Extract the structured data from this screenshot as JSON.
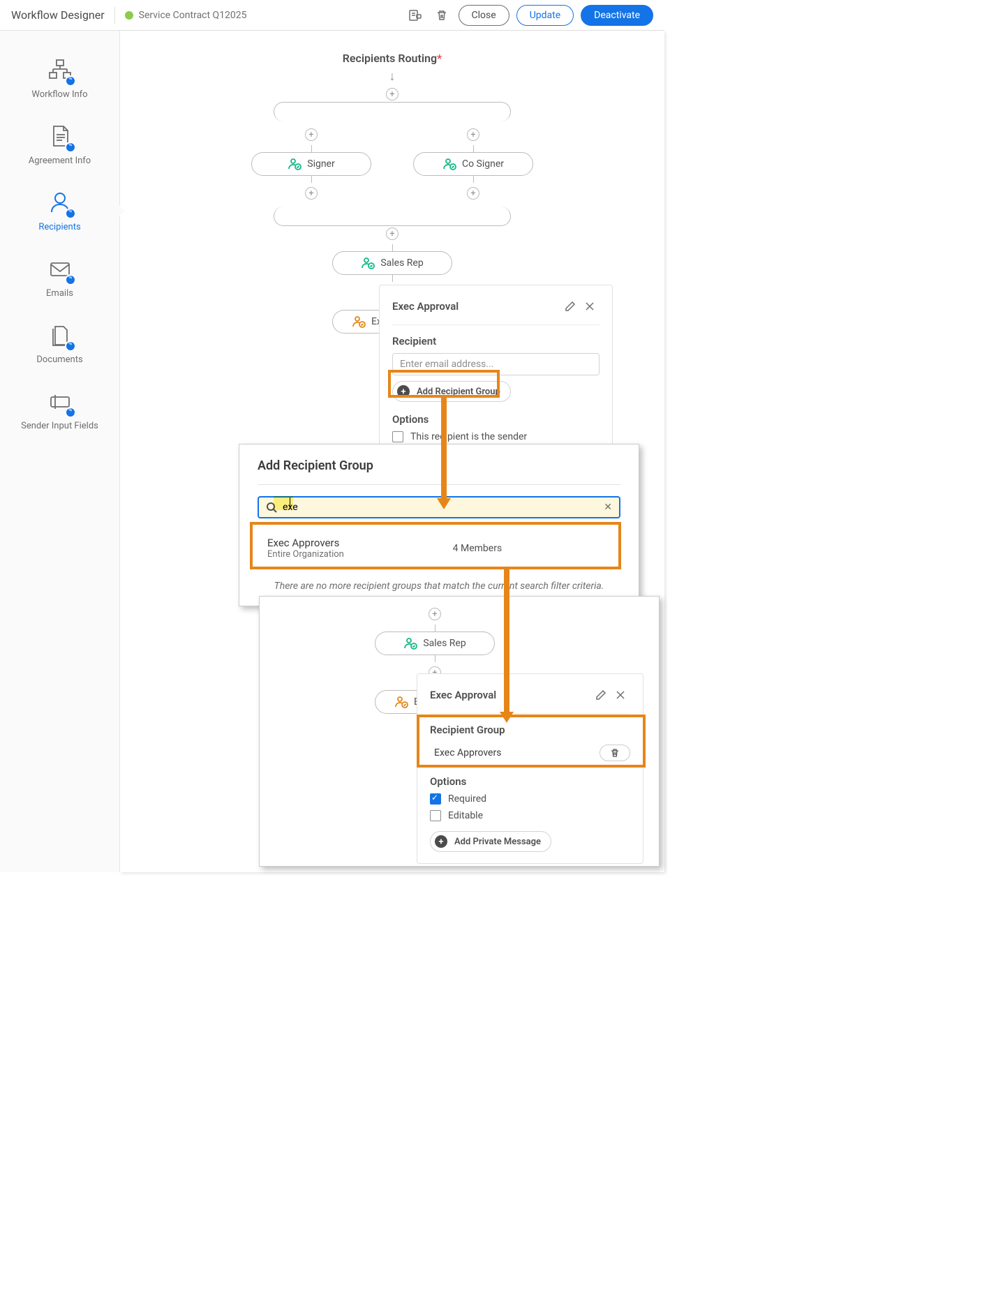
{
  "header": {
    "title": "Workflow Designer",
    "subtitle": "Service Contract Q12025",
    "close": "Close",
    "update": "Update",
    "deactivate": "Deactivate"
  },
  "sidebar": {
    "items": [
      {
        "label": "Workflow Info"
      },
      {
        "label": "Agreement Info"
      },
      {
        "label": "Recipients"
      },
      {
        "label": "Emails"
      },
      {
        "label": "Documents"
      },
      {
        "label": "Sender Input Fields"
      }
    ]
  },
  "routing": {
    "title": "Recipients Routing",
    "nodes": {
      "signer": "Signer",
      "cosigner": "Co Signer",
      "salesrep": "Sales Rep",
      "execapproval": "Exec Approval"
    }
  },
  "panel1": {
    "title": "Exec Approval",
    "recipient_label": "Recipient",
    "placeholder": "Enter email address...",
    "add_group": "Add Recipient Group",
    "options_label": "Options",
    "opt_sender": "This recipient is the sender"
  },
  "dialog": {
    "title": "Add Recipient Group",
    "search_value": "exe",
    "result_name": "Exec Approvers",
    "result_org": "Entire Organization",
    "result_members": "4 Members",
    "no_more": "There are no more recipient groups that match the current search filter criteria."
  },
  "panel2": {
    "title": "Exec Approval",
    "group_label": "Recipient Group",
    "group_name": "Exec Approvers",
    "options_label": "Options",
    "opt_required": "Required",
    "opt_editable": "Editable",
    "add_msg": "Add Private Message",
    "salesrep": "Sales Rep",
    "execapproval": "Exec Approval"
  }
}
